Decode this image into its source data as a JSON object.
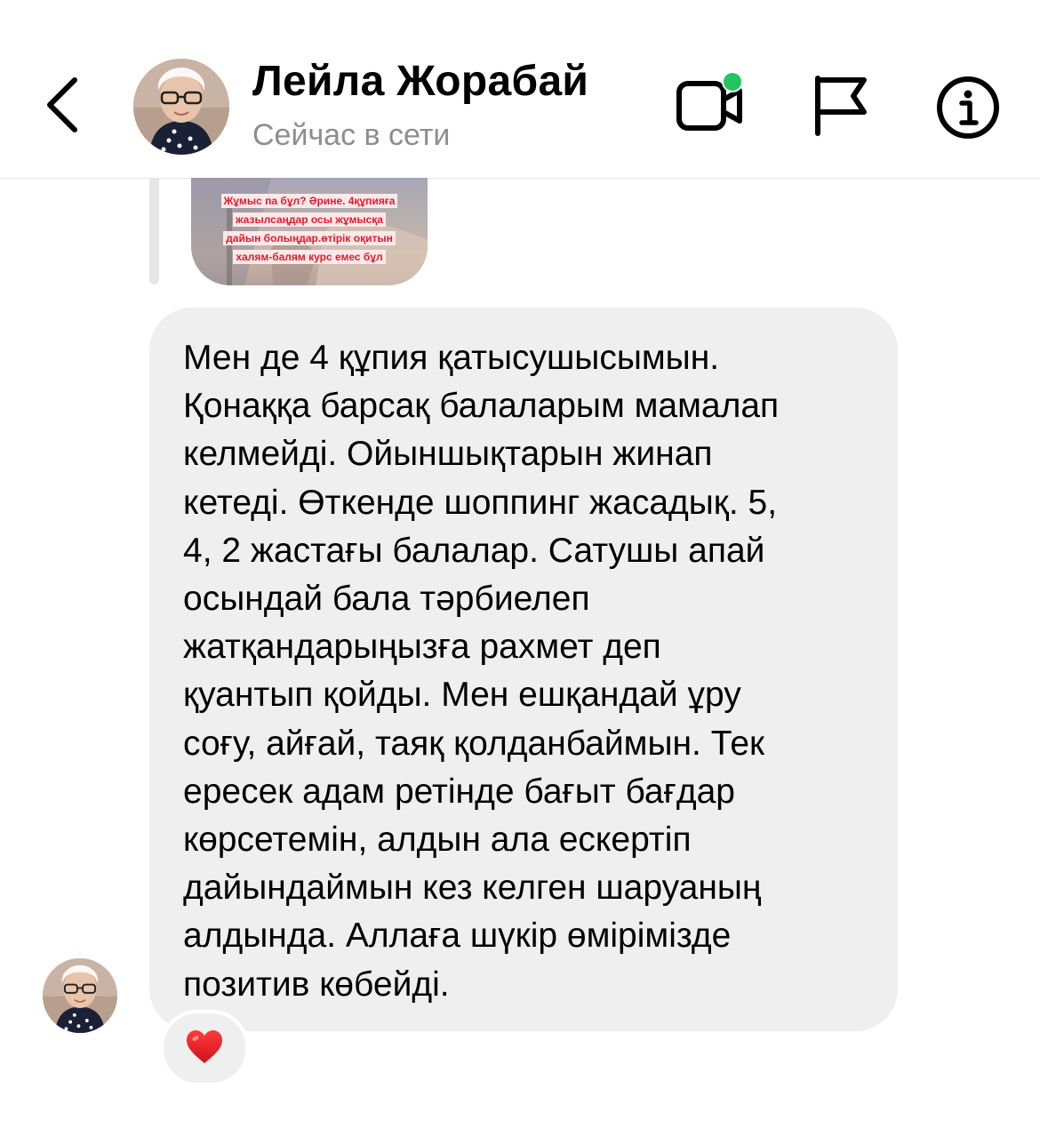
{
  "header": {
    "contact_name": "Лейла Жорабай",
    "contact_status": "Сейчас в сети",
    "online_indicator_color": "#22c55e",
    "icons": [
      "back-chevron-icon",
      "video-call-icon",
      "flag-icon",
      "info-icon"
    ]
  },
  "story_reply": {
    "caption_lines": [
      "Жұмыс па бұл? Әрине. 4құпияға",
      "жазылсаңдар осы жұмысқа",
      "дайын болыңдар.өтірік оқитын",
      "халям-балям курс емес бұл"
    ]
  },
  "message": {
    "lines": [
      "Мен де 4 құпия қатысушысымын.",
      "Қонаққа барсақ балаларым мамалап",
      "келмейді. Ойыншықтарын жинап",
      "кетеді. Өткенде шоппинг жасадық. 5,",
      "4, 2 жастағы балалар. Сатушы апай",
      "осындай бала тәрбиелеп",
      "жатқандарыңызға рахмет деп",
      "қуантып қойды. Мен ешқандай ұру",
      "соғу, айғай, таяқ қолданбаймын. Тек",
      "ересек адам ретінде бағыт бағдар",
      "көрсетемін, алдын ала ескертіп",
      "дайындаймын кез келген шаруаның",
      "алдында. Аллаға шүкір өмірімізде",
      "позитив көбейді."
    ],
    "reaction": "heart-emoji"
  }
}
